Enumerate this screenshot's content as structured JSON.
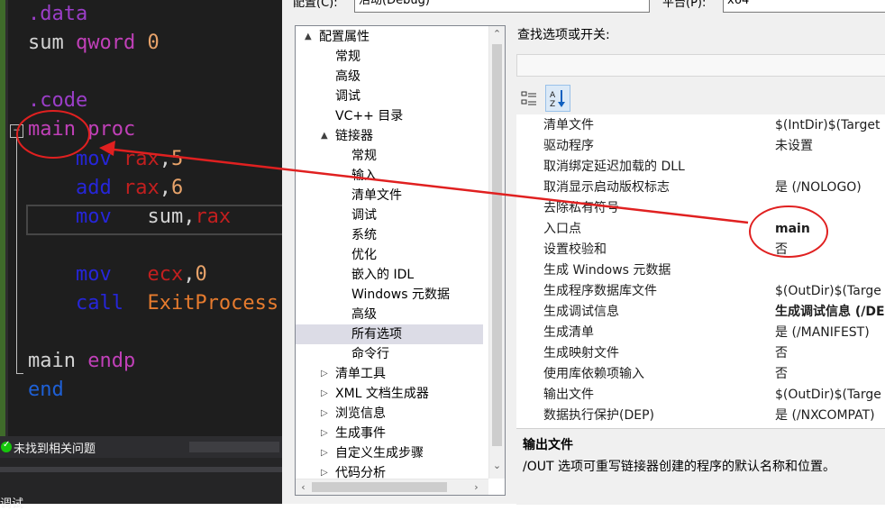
{
  "editor": {
    "lines": [
      {
        "tokens": [
          {
            "t": ".data",
            "c": "kw-dir"
          }
        ]
      },
      {
        "tokens": [
          {
            "t": "sum ",
            "c": "kw-id"
          },
          {
            "t": "qword ",
            "c": "kw-type"
          },
          {
            "t": "0",
            "c": "kw-num"
          }
        ]
      },
      {
        "tokens": []
      },
      {
        "tokens": [
          {
            "t": ".code",
            "c": "kw-dir"
          }
        ]
      },
      {
        "tokens": [
          {
            "t": "main ",
            "c": "kw-proc"
          },
          {
            "t": "proc",
            "c": "kw-proc"
          }
        ]
      },
      {
        "tokens": [
          {
            "t": "    mov ",
            "c": "kw-op"
          },
          {
            "t": "rax",
            "c": "kw-reg"
          },
          {
            "t": ",",
            "c": "kw-id"
          },
          {
            "t": "5",
            "c": "kw-num"
          }
        ]
      },
      {
        "tokens": [
          {
            "t": "    add ",
            "c": "kw-op"
          },
          {
            "t": "rax",
            "c": "kw-reg"
          },
          {
            "t": ",",
            "c": "kw-id"
          },
          {
            "t": "6",
            "c": "kw-num"
          }
        ]
      },
      {
        "tokens": [
          {
            "t": "    mov   ",
            "c": "kw-op"
          },
          {
            "t": "sum,",
            "c": "kw-id"
          },
          {
            "t": "rax",
            "c": "kw-reg"
          }
        ]
      },
      {
        "tokens": []
      },
      {
        "tokens": [
          {
            "t": "    mov   ",
            "c": "kw-op"
          },
          {
            "t": "ecx",
            "c": "kw-reg"
          },
          {
            "t": ",",
            "c": "kw-id"
          },
          {
            "t": "0",
            "c": "kw-num"
          }
        ]
      },
      {
        "tokens": [
          {
            "t": "    call  ",
            "c": "kw-op"
          },
          {
            "t": "ExitProcess",
            "c": "kw-exit"
          }
        ]
      },
      {
        "tokens": []
      },
      {
        "tokens": [
          {
            "t": "main ",
            "c": "kw-id"
          },
          {
            "t": "endp",
            "c": "kw-proc"
          }
        ]
      },
      {
        "tokens": [
          {
            "t": "end",
            "c": "kw-end"
          }
        ]
      }
    ],
    "fold_symbol": "−"
  },
  "status": {
    "issues_text": "未找到相关问题",
    "bottom_text": "调试"
  },
  "dialog": {
    "config_label": "配置(C):",
    "config_value": "活动(Debug)",
    "platform_label": "平台(P):",
    "platform_value": "x64",
    "tree": [
      {
        "label": "配置属性",
        "level": 0,
        "arrow": "▲",
        "selected": false
      },
      {
        "label": "常规",
        "level": 1,
        "arrow": "",
        "selected": false
      },
      {
        "label": "高级",
        "level": 1,
        "arrow": "",
        "selected": false
      },
      {
        "label": "调试",
        "level": 1,
        "arrow": "",
        "selected": false
      },
      {
        "label": "VC++ 目录",
        "level": 1,
        "arrow": "",
        "selected": false
      },
      {
        "label": "链接器",
        "level": 1,
        "arrow": "▲",
        "selected": false
      },
      {
        "label": "常规",
        "level": 2,
        "arrow": "",
        "selected": false
      },
      {
        "label": "输入",
        "level": 2,
        "arrow": "",
        "selected": false
      },
      {
        "label": "清单文件",
        "level": 2,
        "arrow": "",
        "selected": false
      },
      {
        "label": "调试",
        "level": 2,
        "arrow": "",
        "selected": false
      },
      {
        "label": "系统",
        "level": 2,
        "arrow": "",
        "selected": false
      },
      {
        "label": "优化",
        "level": 2,
        "arrow": "",
        "selected": false
      },
      {
        "label": "嵌入的 IDL",
        "level": 2,
        "arrow": "",
        "selected": false
      },
      {
        "label": "Windows 元数据",
        "level": 2,
        "arrow": "",
        "selected": false
      },
      {
        "label": "高级",
        "level": 2,
        "arrow": "",
        "selected": false
      },
      {
        "label": "所有选项",
        "level": 2,
        "arrow": "",
        "selected": true
      },
      {
        "label": "命令行",
        "level": 2,
        "arrow": "",
        "selected": false
      },
      {
        "label": "清单工具",
        "level": 1,
        "arrow": "▷",
        "selected": false
      },
      {
        "label": "XML 文档生成器",
        "level": 1,
        "arrow": "▷",
        "selected": false
      },
      {
        "label": "浏览信息",
        "level": 1,
        "arrow": "▷",
        "selected": false
      },
      {
        "label": "生成事件",
        "level": 1,
        "arrow": "▷",
        "selected": false
      },
      {
        "label": "自定义生成步骤",
        "level": 1,
        "arrow": "▷",
        "selected": false
      },
      {
        "label": "代码分析",
        "level": 1,
        "arrow": "▷",
        "selected": false
      }
    ],
    "search_label": "查找选项或开关:",
    "search_value": "",
    "grid": [
      {
        "name": "清单文件",
        "value": "$(IntDir)$(Target",
        "bold": false
      },
      {
        "name": "驱动程序",
        "value": "未设置",
        "bold": false
      },
      {
        "name": "取消绑定延迟加载的 DLL",
        "value": "",
        "bold": false
      },
      {
        "name": "取消显示启动版权标志",
        "value": "是 (/NOLOGO)",
        "bold": false
      },
      {
        "name": "去除私有符号",
        "value": "",
        "bold": false
      },
      {
        "name": "入口点",
        "value": "main",
        "bold": true
      },
      {
        "name": "设置校验和",
        "value": "否",
        "bold": false
      },
      {
        "name": "生成 Windows 元数据",
        "value": "",
        "bold": false
      },
      {
        "name": "生成程序数据库文件",
        "value": "$(OutDir)$(Targe",
        "bold": false
      },
      {
        "name": "生成调试信息",
        "value": "生成调试信息 (/DE",
        "bold": true
      },
      {
        "name": "生成清单",
        "value": "是 (/MANIFEST)",
        "bold": false
      },
      {
        "name": "生成映射文件",
        "value": "否",
        "bold": false
      },
      {
        "name": "使用库依赖项输入",
        "value": "否",
        "bold": false
      },
      {
        "name": "输出文件",
        "value": "$(OutDir)$(Targe",
        "bold": false
      },
      {
        "name": "数据执行保护(DEP)",
        "value": "是 (/NXCOMPAT)",
        "bold": false
      }
    ],
    "desc_title": "输出文件",
    "desc_text": "/OUT 选项可重写链接器创建的程序的默认名称和位置。"
  },
  "colors": {
    "annotation": "#e02020",
    "editor_bg": "#1e1e1e",
    "selection": "#dcdce6"
  },
  "icons": [
    "categorized-icon",
    "alphabetical-sort-icon",
    "check-icon",
    "chevron-up-icon",
    "chevron-down-icon",
    "chevron-left-icon",
    "chevron-right-icon"
  ]
}
